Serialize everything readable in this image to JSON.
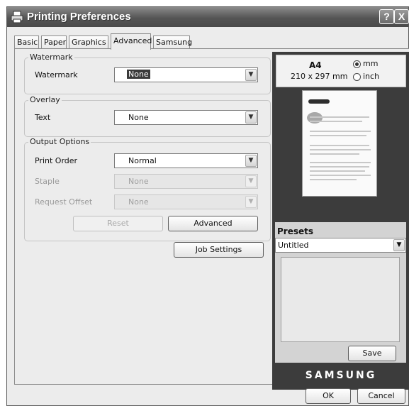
{
  "window": {
    "title": "Printing Preferences",
    "help_glyph": "?",
    "close_glyph": "X"
  },
  "tabs": [
    "Basic",
    "Paper",
    "Graphics",
    "Advanced",
    "Samsung"
  ],
  "active_tab": "Advanced",
  "watermark": {
    "group_title": "Watermark",
    "label": "Watermark",
    "value": "None"
  },
  "overlay": {
    "group_title": "Overlay",
    "label": "Text",
    "value": "None"
  },
  "output_options": {
    "group_title": "Output Options",
    "print_order": {
      "label": "Print Order",
      "value": "Normal"
    },
    "staple": {
      "label": "Staple",
      "value": "None"
    },
    "request_offset": {
      "label": "Request Offset",
      "value": "None"
    },
    "reset_label": "Reset",
    "advanced_label": "Advanced"
  },
  "job_settings_label": "Job Settings",
  "preview": {
    "paper_size": "A4",
    "paper_dims": "210 x 297 mm",
    "unit_mm": "mm",
    "unit_inch": "inch",
    "selected_unit": "mm"
  },
  "presets": {
    "title": "Presets",
    "value": "Untitled",
    "save_label": "Save"
  },
  "brand": "SAMSUNG",
  "footer": {
    "ok_label": "OK",
    "cancel_label": "Cancel"
  },
  "icons": {
    "title_icon": "printer-icon",
    "dropdown_arrow": "chevron-down-icon",
    "dropdown_glyph": "▼"
  }
}
